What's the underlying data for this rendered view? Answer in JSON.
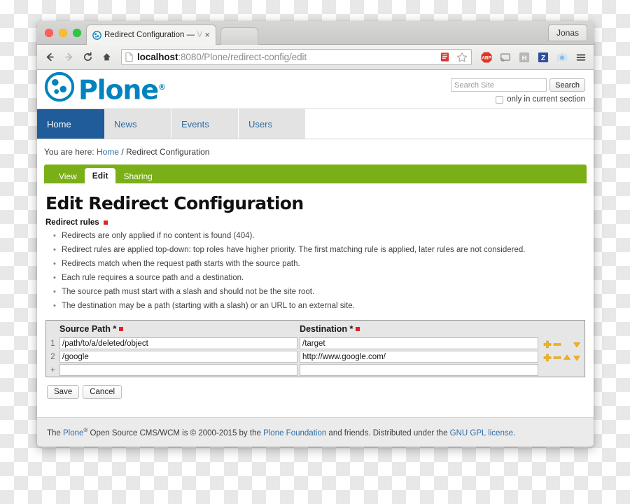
{
  "browser": {
    "tab": {
      "favicon": "plone-favicon",
      "title": "Redirect Configuration —",
      "title_muted": "V",
      "close_label": "×"
    },
    "profile_label": "Jonas",
    "nav": {
      "back_icon": "back-arrow-icon",
      "forward_icon": "forward-arrow-icon",
      "reload_icon": "reload-icon",
      "home_icon": "home-icon"
    },
    "omnibox": {
      "page_icon": "page-document-icon",
      "url_host": "localhost",
      "url_rest": ":8080/Plone/redirect-config/edit",
      "bookmark_icon": "star-icon",
      "reader_icon": "reader-mode-icon"
    },
    "extensions": [
      {
        "name": "adblock-plus-icon",
        "label": "ABP"
      },
      {
        "name": "cast-icon",
        "label": ""
      },
      {
        "name": "hypothesis-icon",
        "label": "H"
      },
      {
        "name": "zotero-icon",
        "label": "Z"
      },
      {
        "name": "screenshot-icon",
        "label": ""
      },
      {
        "name": "chrome-menu-icon",
        "label": ""
      }
    ]
  },
  "site": {
    "logo_text": "Plone",
    "logo_mark": "plone-logo-icon",
    "registered_mark": "®",
    "search": {
      "placeholder": "Search Site",
      "value": "",
      "button_label": "Search",
      "checkbox_label": "only in current section",
      "checkbox_checked": false
    },
    "nav_items": [
      {
        "label": "Home",
        "active": true
      },
      {
        "label": "News",
        "active": false
      },
      {
        "label": "Events",
        "active": false
      },
      {
        "label": "Users",
        "active": false
      }
    ],
    "breadcrumb": {
      "prefix": "You are here:",
      "home": "Home",
      "separator": "/",
      "current": "Redirect Configuration"
    },
    "content_tabs": [
      {
        "label": "View",
        "active": false
      },
      {
        "label": "Edit",
        "active": true
      },
      {
        "label": "Sharing",
        "active": false
      }
    ],
    "footer": {
      "t1": "The ",
      "link1": "Plone",
      "sup": "®",
      "t2": " Open Source CMS/WCM is © 2000-2015 by the ",
      "link2": "Plone Foundation",
      "t3": " and friends. Distributed under the ",
      "link3": "GNU GPL license",
      "t4": "."
    }
  },
  "page": {
    "title": "Edit Redirect Configuration",
    "field_label": "Redirect rules",
    "required_marker": "required",
    "rules": [
      "Redirects are only applied if no content is found (404).",
      "Redirect rules are applied top-down: top roles have higher priority. The first matching rule is applied, later rules are not considered.",
      "Redirects match when the request path starts with the source path.",
      "Each rule requires a source path and a destination.",
      "The source path must start with a slash and should not be the site root.",
      "The destination may be a path (starting with a slash) or an URL to an external site."
    ],
    "table": {
      "headers": {
        "source": "Source Path *",
        "destination": "Destination *"
      },
      "rows": [
        {
          "num": "1",
          "source": "/path/to/a/deleted/object",
          "destination": "/target",
          "actions": [
            "add-row-icon",
            "remove-row-icon",
            "move-down-icon"
          ]
        },
        {
          "num": "2",
          "source": "/google",
          "destination": "http://www.google.com/",
          "actions": [
            "add-row-icon",
            "remove-row-icon",
            "move-up-icon",
            "move-down-icon"
          ]
        }
      ],
      "new_row": {
        "num": "+",
        "source": "",
        "destination": "",
        "source_placeholder": "",
        "destination_placeholder": ""
      }
    },
    "buttons": [
      {
        "label": "Save",
        "name": "save-button"
      },
      {
        "label": "Cancel",
        "name": "cancel-button"
      }
    ]
  },
  "colors": {
    "plone_blue": "#0083be",
    "nav_active_blue": "#1f5c99",
    "nav_link_blue": "#2e6da4",
    "green_bar": "#7aaf18",
    "required_red": "#e52121",
    "action_gold": "#f2b21c"
  }
}
